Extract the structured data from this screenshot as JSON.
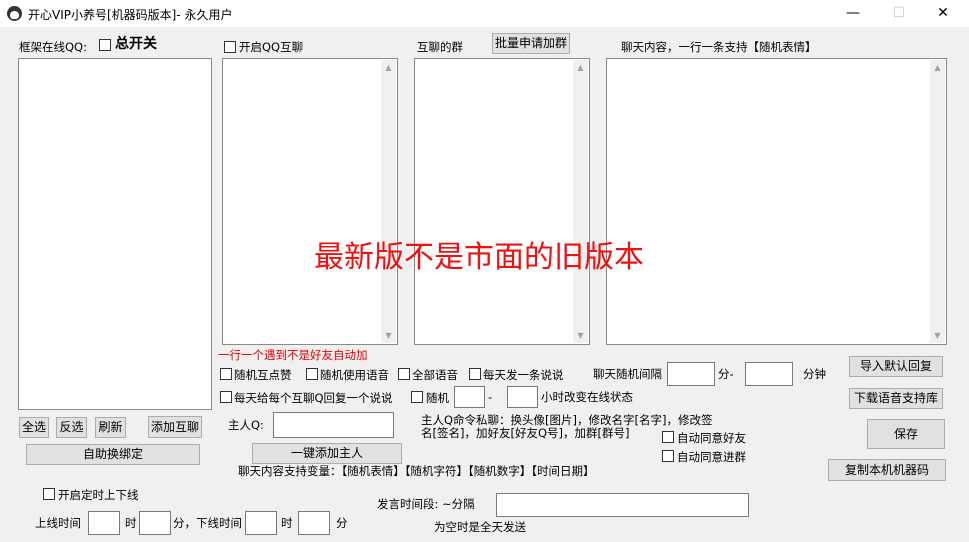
{
  "window": {
    "title": "开心VIP小养号[机器码版本]- 永久用户",
    "minimize": "—",
    "maximize": "☐",
    "close": "✕"
  },
  "labels": {
    "frame_online_qq": "框架在线QQ:",
    "master_switch": "总开关",
    "enable_qq_chat": "开启QQ互聊",
    "mutual_groups": "互聊的群",
    "chat_content": "聊天内容，一行一条支持【随机表情】",
    "red_note": "一行一个遇到不是好友自动加",
    "owner_q": "主人Q:",
    "owner_cmd_line1": "主人Q命令私聊：换头像[图片]，修改名字[名字]，修改签",
    "owner_cmd_line2": "名[签名]，加好友[好友Q号]，加群[群号]",
    "chat_vars": "聊天内容支持变量：【随机表情】【随机字符】【随机数字】【时间日期】",
    "random_interval": "聊天随机间隔",
    "min_dash": "分-",
    "minute": "分钟",
    "random": "随机",
    "dash": "-",
    "hours_change_status": "小时改变在线状态",
    "timed_online": "开启定时上下线",
    "online_time": "上线时间",
    "hour": "时",
    "min_offline": "分，下线时间",
    "hour2": "时",
    "min2": "分",
    "speak_period": "发言时间段: ~分隔",
    "empty_all_day": "为空时是全天发送"
  },
  "checkboxes": {
    "random_like": "随机互点赞",
    "random_voice": "随机使用语音",
    "all_voice": "全部语音",
    "daily_post": "每天发一条说说",
    "daily_reply": "每天给每个互聊Q回复一个说说",
    "auto_accept_friend": "自动同意好友",
    "auto_accept_group": "自动同意进群"
  },
  "buttons": {
    "batch_join_group": "批量申请加群",
    "select_all": "全选",
    "invert": "反选",
    "refresh": "刷新",
    "add_mutual": "添加互聊",
    "auto_bind": "自助换绑定",
    "add_owner": "一键添加主人",
    "import_reply": "导入默认回复",
    "download_voice": "下载语音支持库",
    "save": "保存",
    "copy_machine_code": "复制本机机器码"
  },
  "banner": "最新版不是市面的旧版本",
  "colors": {
    "banner": "#f01010",
    "red_note": "#e00000"
  }
}
